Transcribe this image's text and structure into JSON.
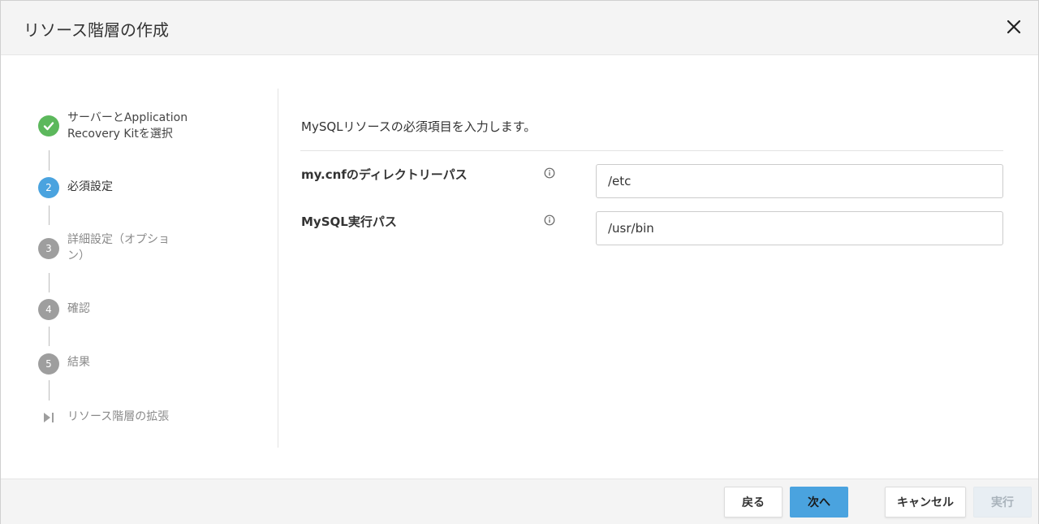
{
  "dialog": {
    "title": "リソース階層の作成",
    "close_icon": "close-icon"
  },
  "steps": [
    {
      "number": "",
      "label_line1": "サーバーとApplication",
      "label_line2": "Recovery Kitを選択",
      "state": "done",
      "icon": "check-icon"
    },
    {
      "number": "2",
      "label_line1": "必須設定",
      "state": "active"
    },
    {
      "number": "3",
      "label_line1": "詳細設定（オプショ",
      "label_line2": "ン）",
      "state": "inactive"
    },
    {
      "number": "4",
      "label_line1": "確認",
      "state": "inactive"
    },
    {
      "number": "5",
      "label_line1": "結果",
      "state": "inactive"
    },
    {
      "number": "",
      "label_line1": "リソース階層の拡張",
      "state": "inactive",
      "icon": "skip-forward-icon"
    }
  ],
  "main": {
    "description": "MySQLリソースの必須項目を入力します。",
    "fields": [
      {
        "label": "my.cnfのディレクトリーパス",
        "value": "/etc",
        "info_icon": "info-icon"
      },
      {
        "label": "MySQL実行パス",
        "value": "/usr/bin",
        "info_icon": "info-icon"
      }
    ]
  },
  "footer": {
    "back_label": "戻る",
    "next_label": "次へ",
    "cancel_label": "キャンセル",
    "run_label": "実行"
  },
  "colors": {
    "accent": "#4aa3df",
    "done": "#5cb85c",
    "inactive_step": "#9e9e9e",
    "header_bg": "#f4f4f4"
  }
}
